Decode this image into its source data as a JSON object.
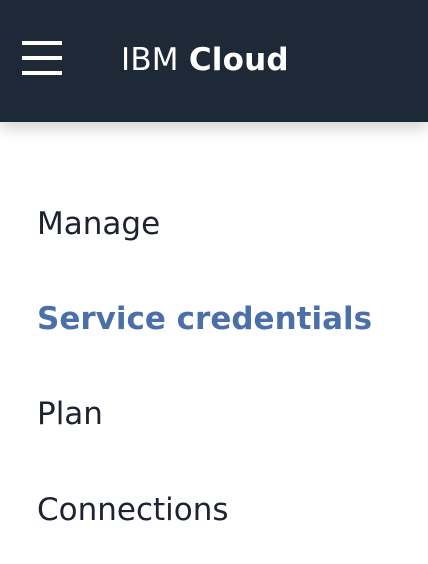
{
  "header": {
    "menu_icon": "hamburger-menu-icon",
    "brand_light": "IBM",
    "brand_bold": "Cloud"
  },
  "nav": {
    "items": [
      {
        "label": "Manage",
        "active": false
      },
      {
        "label": "Service credentials",
        "active": true
      },
      {
        "label": "Plan",
        "active": false
      },
      {
        "label": "Connections",
        "active": false
      }
    ]
  },
  "colors": {
    "header_background": "#1d2936",
    "active_item": "#4a6fa9",
    "item_text": "#1d2330",
    "header_text": "#ffffff"
  }
}
